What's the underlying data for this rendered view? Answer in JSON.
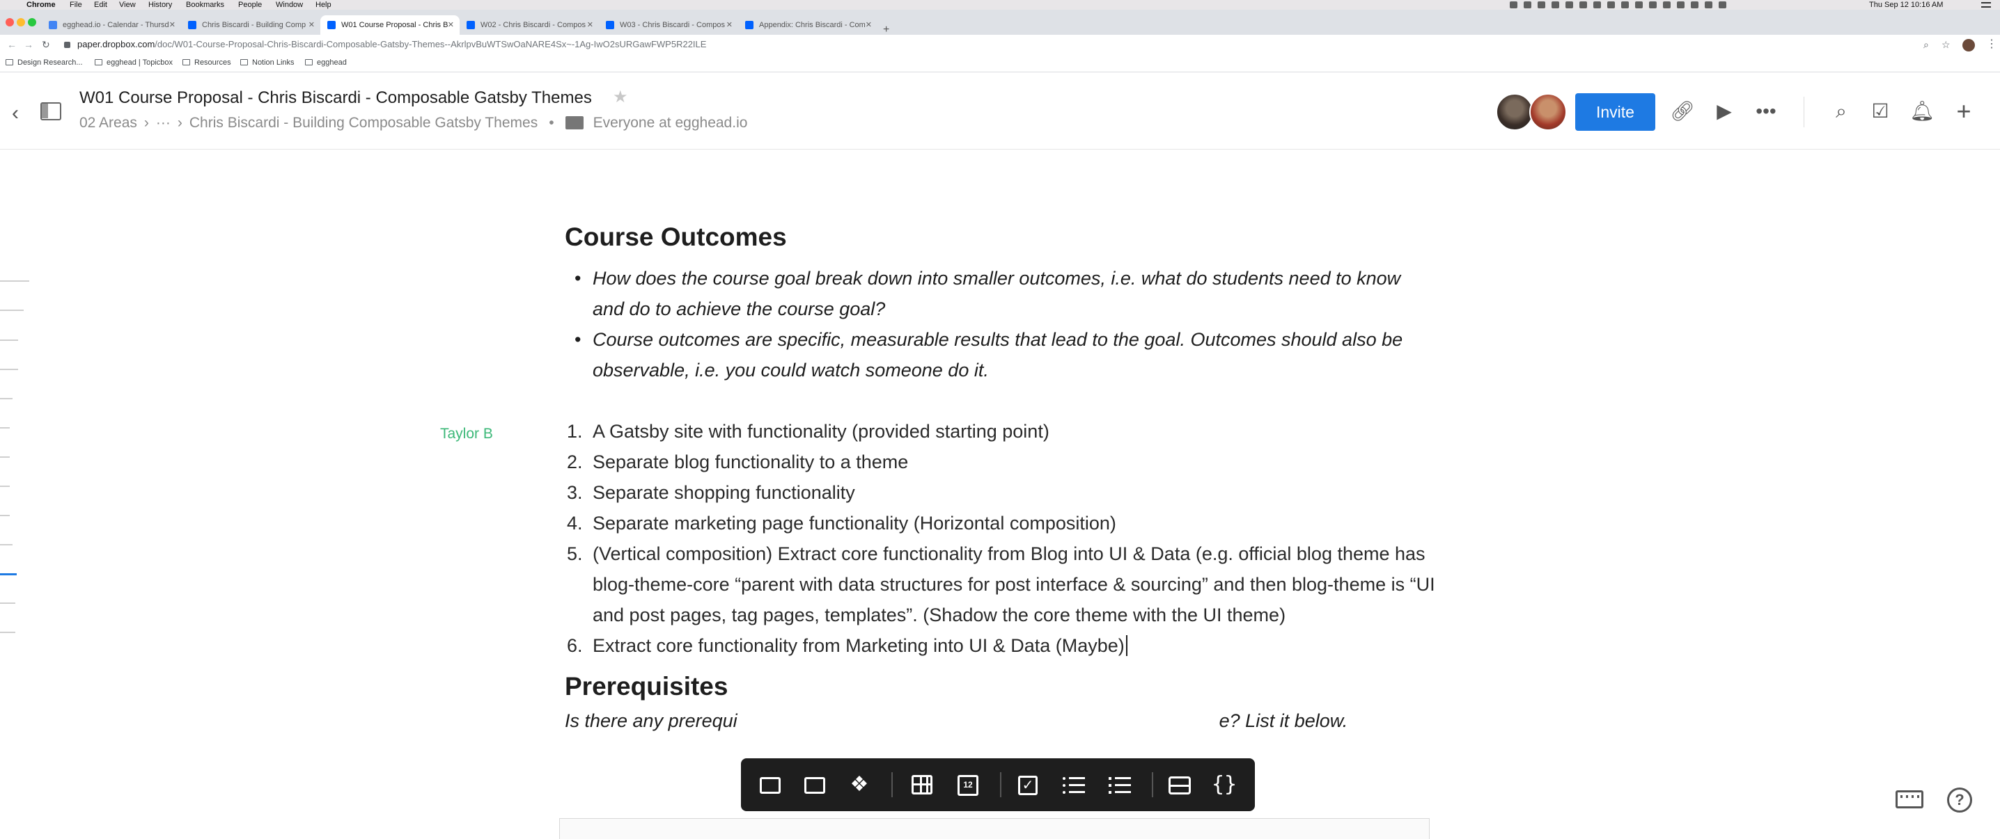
{
  "menubar": {
    "apple": "",
    "app": "Chrome",
    "items": [
      "File",
      "Edit",
      "View",
      "History",
      "Bookmarks",
      "People",
      "Window",
      "Help"
    ],
    "clock": "Thu Sep 12  10:16 AM"
  },
  "tabs": [
    {
      "label": "egghead.io - Calendar - Thursd",
      "active": false,
      "color": "#4285f4"
    },
    {
      "label": "Chris Biscardi - Building Comp",
      "active": false,
      "color": "#0061fe"
    },
    {
      "label": "W01 Course Proposal - Chris B",
      "active": true,
      "color": "#0061fe"
    },
    {
      "label": "W02 - Chris Biscardi - Compos",
      "active": false,
      "color": "#0061fe"
    },
    {
      "label": "W03 - Chris Biscardi - Compos",
      "active": false,
      "color": "#0061fe"
    },
    {
      "label": "Appendix: Chris Biscardi - Com",
      "active": false,
      "color": "#0061fe"
    }
  ],
  "newtab": "+",
  "address": {
    "domain": "paper.dropbox.com",
    "path": "/doc/W01-Course-Proposal-Chris-Biscardi-Composable-Gatsby-Themes--AkrlpvBuWTSwOaNARE4Sx~-1Ag-IwO2sURGawFWP5R22ILE"
  },
  "bookmarks": [
    "Design Research...",
    "egghead | Topicbox",
    "Resources",
    "Notion Links",
    "egghead"
  ],
  "header": {
    "title": "W01 Course Proposal - Chris Biscardi - Composable Gatsby Themes",
    "crumb_area": "02 Areas",
    "crumb_sep": "›",
    "crumb_ellipsis": "···",
    "crumb_folder": "Chris Biscardi - Building Composable Gatsby Themes",
    "crumb_dot": "•",
    "share": "Everyone at egghead.io",
    "invite": "Invite",
    "accent": "#1e7ae3"
  },
  "doc": {
    "heading": "Course Outcomes",
    "prompts": [
      "How does the course goal break down into smaller outcomes, i.e. what do students need to know and do to achieve the course goal?",
      "Course outcomes are specific, measurable results that lead to the goal. Outcomes should also be observable, i.e. you could watch someone do it."
    ],
    "author": "Taylor B",
    "outcomes": [
      {
        "n": "1.",
        "text": "A Gatsby site with functionality (provided starting point)"
      },
      {
        "n": "2.",
        "text": "Separate blog functionality to a theme"
      },
      {
        "n": "3.",
        "text": "Separate shopping functionality"
      },
      {
        "n": "4.",
        "text": "Separate marketing page functionality  (Horizontal composition)"
      },
      {
        "n": "5.",
        "text": "(Vertical composition) Extract core functionality from Blog into UI & Data (e.g. official blog theme has blog-theme-core “parent with data structures for post interface & sourcing” and then blog-theme is “UI and post pages, tag pages, templates”.  (Shadow the core theme with the UI theme)"
      },
      {
        "n": "6.",
        "text": "Extract core functionality from Marketing into UI & Data (Maybe)"
      }
    ],
    "heading2": "Prerequisites",
    "prereq_left": "Is there any prerequi",
    "prereq_right": "e? List it below."
  },
  "insert_toolbar": {
    "calendar_day": "12"
  },
  "colors": {
    "author_tag": "#3cb878",
    "toolbar_bg": "#1e1e1e"
  }
}
